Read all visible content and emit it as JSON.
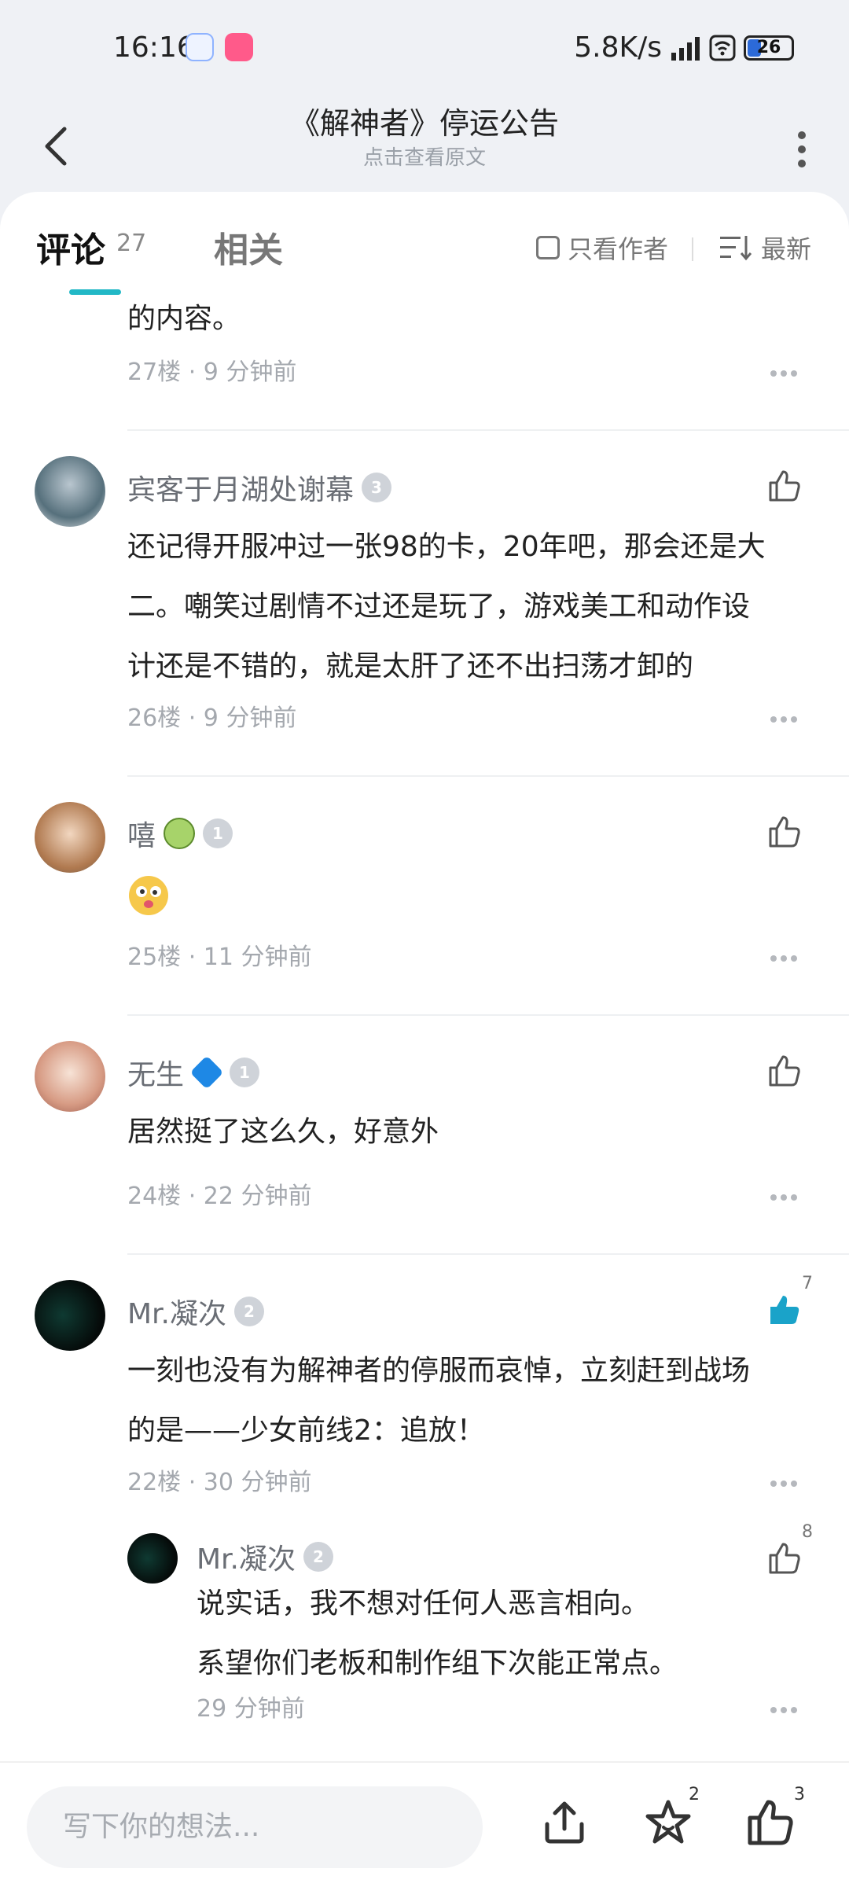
{
  "status": {
    "time": "16:16",
    "network": "5.8K/s",
    "battery": "26"
  },
  "header": {
    "title": "《解神者》停运公告",
    "subtitle": "点击查看原文"
  },
  "tabs": {
    "comments_label": "评论",
    "comments_count": "27",
    "related_label": "相关",
    "author_only": "只看作者",
    "sort_label": "最新"
  },
  "comments": [
    {
      "text": "的内容。",
      "floor": "27楼",
      "time": "9 分钟前"
    },
    {
      "user": "宾客于月湖处谢幕",
      "level": "3",
      "text": [
        "还记得开服冲过一张98的卡，20年吧，那会还是大",
        "二。嘲笑过剧情不过还是玩了，游戏美工和动作设",
        "计还是不错的，就是太肝了还不出扫荡才卸的"
      ],
      "floor": "26楼",
      "time": "9 分钟前"
    },
    {
      "user": "嘻",
      "level": "1",
      "floor": "25楼",
      "time": "11 分钟前"
    },
    {
      "user": "无生",
      "level": "1",
      "text": "居然挺了这么久，好意外",
      "floor": "24楼",
      "time": "22 分钟前"
    },
    {
      "user": "Mr.凝次",
      "level": "2",
      "likes": "7",
      "text": [
        "一刻也没有为解神者的停服而哀悼，立刻赶到战场",
        "的是——少女前线2：追放！"
      ],
      "floor": "22楼",
      "time": "30 分钟前",
      "reply": {
        "user": "Mr.凝次",
        "level": "2",
        "likes": "8",
        "text": [
          "说实话，我不想对任何人恶言相向。",
          "系望你们老板和制作组下次能正常点。"
        ],
        "time": "29 分钟前"
      }
    }
  ],
  "bottom": {
    "placeholder": "写下你的想法...",
    "star_count": "2",
    "like_count": "3"
  },
  "colors": {
    "accent": "#22b8c6",
    "liked": "#1aa3c9"
  }
}
